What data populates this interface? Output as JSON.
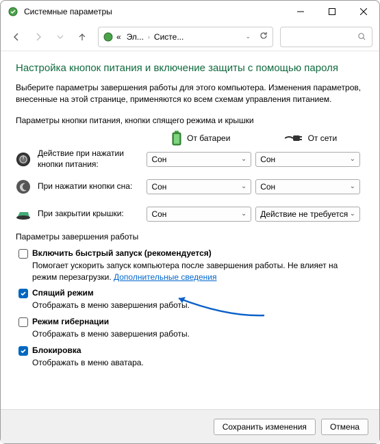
{
  "window": {
    "title": "Системные параметры"
  },
  "breadcrumb": {
    "item1": "Эл...",
    "item2": "Систе..."
  },
  "header": {
    "battery": "От батареи",
    "ac": "От сети"
  },
  "page": {
    "title": "Настройка кнопок питания и включение защиты с помощью пароля",
    "description": "Выберите параметры завершения работы для этого компьютера. Изменения параметров, внесенные на этой странице, применяются ко всем схемам управления питанием.",
    "buttons_section": "Параметры кнопки питания, кнопки спящего режима и крышки",
    "shutdown_section": "Параметры завершения работы"
  },
  "rows": {
    "power": {
      "label": "Действие при нажатии кнопки питания:",
      "battery": "Сон",
      "ac": "Сон"
    },
    "sleep": {
      "label": "При нажатии кнопки сна:",
      "battery": "Сон",
      "ac": "Сон"
    },
    "lid": {
      "label": "При закрытии крышки:",
      "battery": "Сон",
      "ac": "Действие не требуется"
    }
  },
  "shutdown": {
    "fast_startup": {
      "label": "Включить быстрый запуск (рекомендуется)",
      "desc_pre": "Помогает ускорить запуск компьютера после завершения работы. Не влияет на режим перезагрузки. ",
      "link": "Дополнительные сведения"
    },
    "sleep": {
      "label": "Спящий режим",
      "desc": "Отображать в меню завершения работы."
    },
    "hibernate": {
      "label": "Режим гибернации",
      "desc": "Отображать в меню завершения работы."
    },
    "lock": {
      "label": "Блокировка",
      "desc": "Отображать в меню аватара."
    }
  },
  "footer": {
    "save": "Сохранить изменения",
    "cancel": "Отмена"
  }
}
